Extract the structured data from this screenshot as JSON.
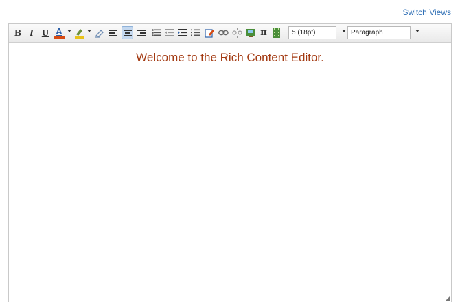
{
  "header": {
    "switch_views": "Switch Views"
  },
  "toolbar": {
    "bold": "B",
    "italic": "I",
    "underline": "U",
    "font_color_glyph": "A",
    "pi_glyph": "π",
    "font_size_value": "5 (18pt)",
    "format_value": "Paragraph",
    "accent_color": "#d64a12",
    "highlight_color": "#e8c21a",
    "active_color": "#c4d8ef"
  },
  "editor": {
    "welcome_text": "Welcome to the Rich Content Editor.",
    "text_color": "#a33a12"
  }
}
